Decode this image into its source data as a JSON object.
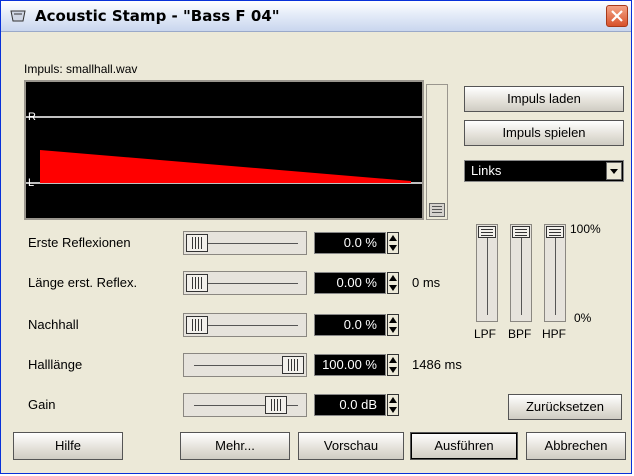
{
  "window": {
    "title": "Acoustic Stamp - \"Bass F 04\""
  },
  "impulse": {
    "label": "Impuls: smallhall.wav",
    "channel_top": "R",
    "channel_bottom": "L",
    "waveform_color": "#ff0000"
  },
  "right_panel": {
    "load_button": "Impuls laden",
    "play_button": "Impuls spielen",
    "channel_select": "Links"
  },
  "params": [
    {
      "label": "Erste Reflexionen",
      "value": "0.0 %",
      "unit": "",
      "slider_level": 0.0
    },
    {
      "label": "Länge erst. Reflex.",
      "value": "0.00 %",
      "unit": "0 ms",
      "slider_level": 0.0
    },
    {
      "label": "Nachhall",
      "value": "0.0 %",
      "unit": "",
      "slider_level": 0.0
    },
    {
      "label": "Halllänge",
      "value": "100.00 %",
      "unit": "1486 ms",
      "slider_level": 1.0
    },
    {
      "label": "Gain",
      "value": "0.0 dB",
      "unit": "",
      "slider_level": 0.82
    }
  ],
  "filters": {
    "max_label": "100%",
    "min_label": "0%",
    "lpf": "LPF",
    "bpf": "BPF",
    "hpf": "HPF",
    "levels": [
      1.0,
      1.0,
      1.0
    ]
  },
  "reset_button": "Zurücksetzen",
  "bottom_buttons": {
    "help": "Hilfe",
    "more": "Mehr...",
    "preview": "Vorschau",
    "execute": "Ausführen",
    "cancel": "Abbrechen"
  }
}
